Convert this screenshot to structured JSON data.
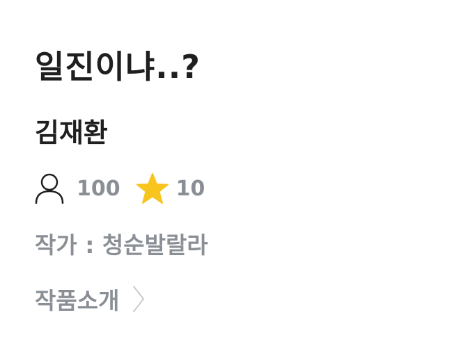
{
  "work": {
    "title": "일진이냐..?",
    "subtitle": "김재환",
    "views": "100",
    "likes": "10",
    "author_line": "작가 : 청순발랄라",
    "intro_label": "작품소개"
  },
  "icons": {
    "views": "person-outline-icon",
    "likes": "star-icon",
    "intro": "chevron-right-icon"
  },
  "colors": {
    "title": "#1f1f1f",
    "muted": "#8a8f96",
    "star": "#f7c51e",
    "chevron": "#c8cbd0"
  }
}
